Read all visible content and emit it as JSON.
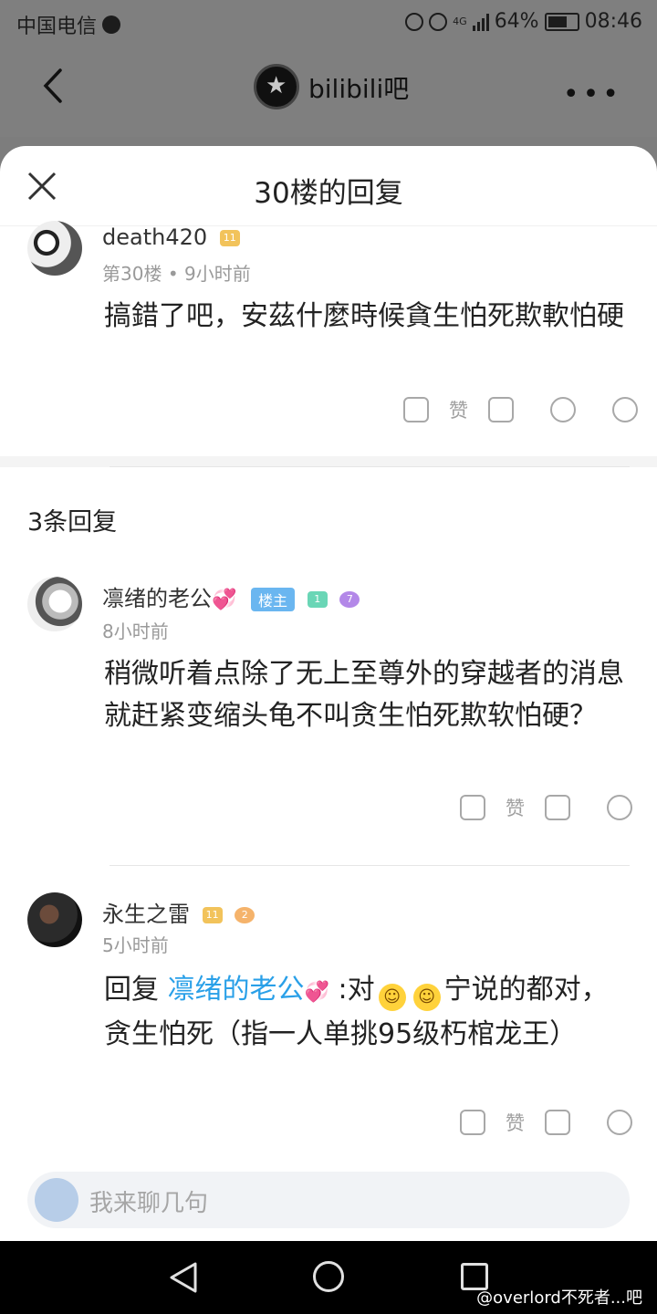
{
  "status_bar": {
    "carrier": "中国电信",
    "battery": "64%",
    "time": "08:46",
    "network": "4G"
  },
  "header": {
    "forum_name": "bilibili吧"
  },
  "sheet": {
    "title": "30楼的回复"
  },
  "main_post": {
    "username": "death420",
    "level": "11",
    "floor": "第30楼",
    "time": "9小时前",
    "content": "搞錯了吧，安茲什麼時候貪生怕死欺軟怕硬",
    "like_label": "赞"
  },
  "reply_count": "3条回复",
  "replies": [
    {
      "username": "凛绪的老公",
      "owner_tag": "楼主",
      "level": "1",
      "badge2": "7",
      "time": "8小时前",
      "content": "稍微听着点除了无上至尊外的穿越者的消息就赶紧变缩头龟不叫贪生怕死欺软怕硬？",
      "like_label": "赞"
    },
    {
      "username": "永生之雷",
      "level": "11",
      "badge2": "2",
      "time": "5小时前",
      "reply_prefix": "回复",
      "mention": "凛绪的老公",
      "content_a": ":对",
      "content_b": "宁说的都对，贪生怕死（指一人单挑95级朽棺龙王）",
      "like_label": "赞"
    }
  ],
  "input": {
    "placeholder": "我来聊几句"
  },
  "watermark": "@overlord不死者...吧",
  "colors": {
    "accent": "#2aa0e8",
    "owner_tag": "#6ab6f0"
  }
}
